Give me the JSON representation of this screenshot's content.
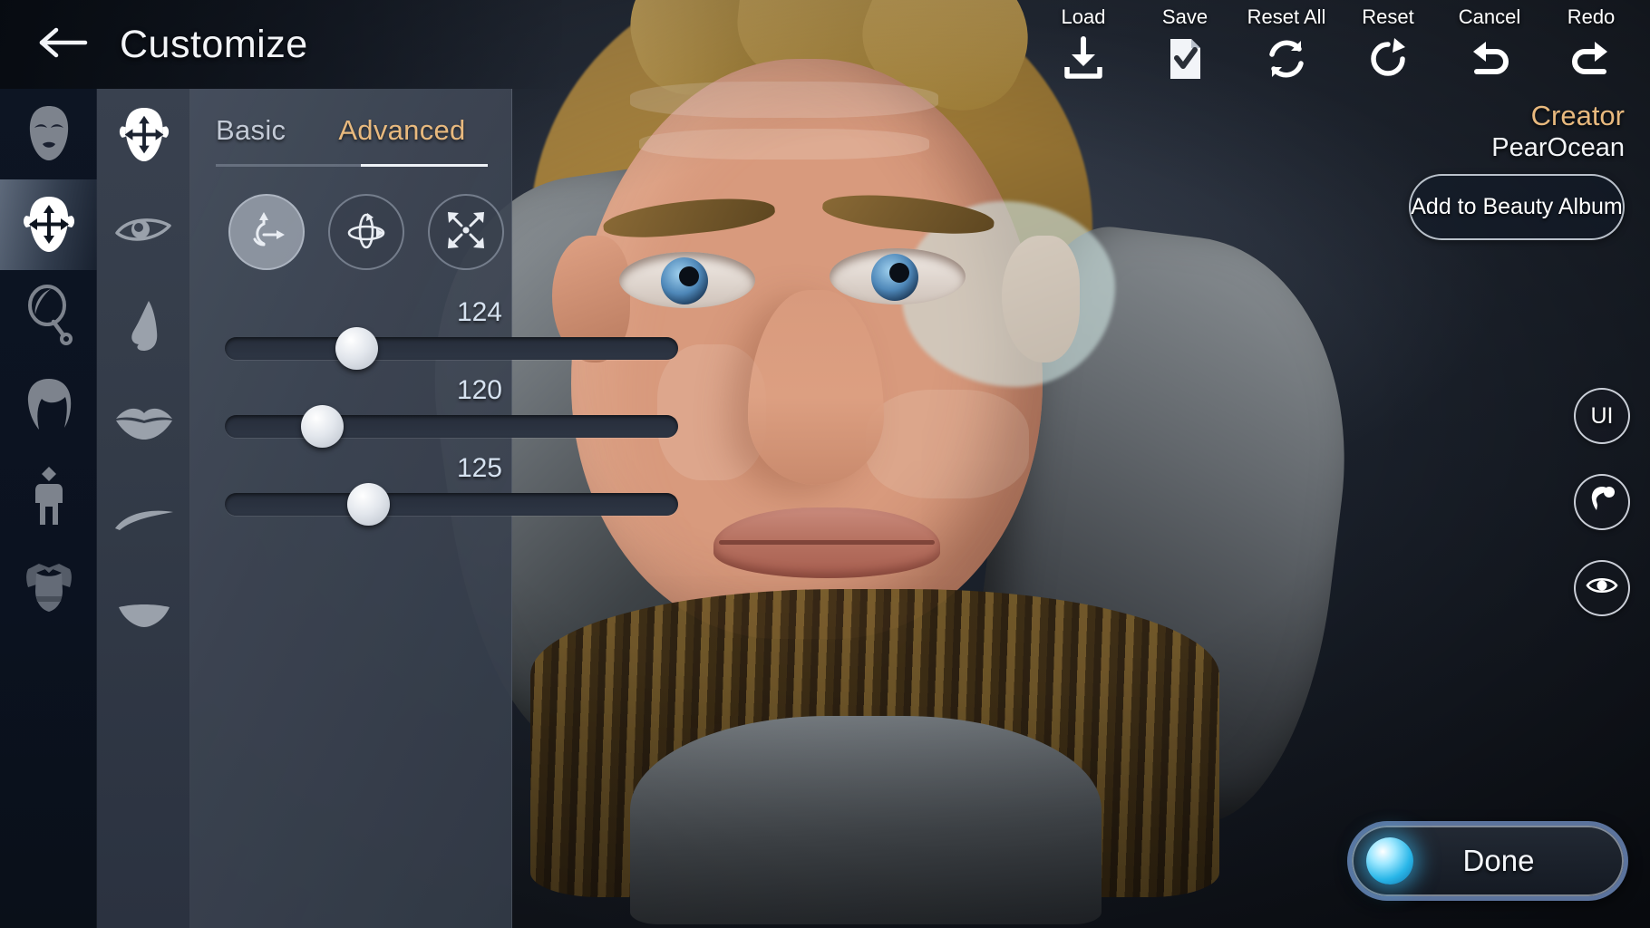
{
  "header": {
    "back_icon": "arrow-left-icon",
    "title": "Customize"
  },
  "toolbar": {
    "items": [
      {
        "label": "Load",
        "icon": "download-icon"
      },
      {
        "label": "Save",
        "icon": "document-check-icon"
      },
      {
        "label": "Reset All",
        "icon": "refresh-double-icon"
      },
      {
        "label": "Reset",
        "icon": "refresh-single-icon"
      },
      {
        "label": "Cancel",
        "icon": "undo-icon"
      },
      {
        "label": "Redo",
        "icon": "redo-icon"
      }
    ]
  },
  "creator": {
    "title": "Creator",
    "name": "PearOcean",
    "album_button": "Add to Beauty Album",
    "title_color": "#e8b97e"
  },
  "sidebar": {
    "items": [
      {
        "name": "face-preset",
        "icon": "face-icon",
        "active": false
      },
      {
        "name": "face-shape",
        "icon": "face-move-icon",
        "active": true
      },
      {
        "name": "makeup",
        "icon": "hand-mirror-icon",
        "active": false
      },
      {
        "name": "hair",
        "icon": "hair-icon",
        "active": false
      },
      {
        "name": "body",
        "icon": "body-icon",
        "active": false
      },
      {
        "name": "outfit",
        "icon": "armor-icon",
        "active": false
      }
    ]
  },
  "subsidebar": {
    "items": [
      {
        "name": "face-overall",
        "icon": "face-move-icon",
        "active": true
      },
      {
        "name": "eyes",
        "icon": "eye-icon",
        "active": false
      },
      {
        "name": "nose",
        "icon": "nose-icon",
        "active": false
      },
      {
        "name": "lips",
        "icon": "lips-icon",
        "active": false
      },
      {
        "name": "eyebrows",
        "icon": "eyebrow-icon",
        "active": false
      },
      {
        "name": "mouth-shape",
        "icon": "mouth-icon",
        "active": false
      }
    ]
  },
  "panel": {
    "tabs": [
      {
        "label": "Basic",
        "active": false
      },
      {
        "label": "Advanced",
        "active": true
      }
    ],
    "transform_buttons": [
      {
        "name": "move-tool",
        "icon": "move-axis-icon",
        "active": true
      },
      {
        "name": "rotate-tool",
        "icon": "rotate-3d-icon",
        "active": false
      },
      {
        "name": "scale-tool",
        "icon": "scale-icon",
        "active": false
      }
    ],
    "sliders": [
      {
        "name": "slider-1",
        "value": "124",
        "percent": 31
      },
      {
        "name": "slider-2",
        "value": "120",
        "percent": 22
      },
      {
        "name": "slider-3",
        "value": "125",
        "percent": 33
      }
    ],
    "accent_color": "#e8b97e"
  },
  "side_buttons": [
    {
      "name": "ui-toggle",
      "label": "UI",
      "icon": ""
    },
    {
      "name": "head-view",
      "label": "",
      "icon": "head-profile-icon"
    },
    {
      "name": "visibility",
      "label": "",
      "icon": "eye-icon"
    }
  ],
  "done": {
    "label": "Done",
    "orb_color": "#29b6e8",
    "border_color": "#5b739d"
  }
}
